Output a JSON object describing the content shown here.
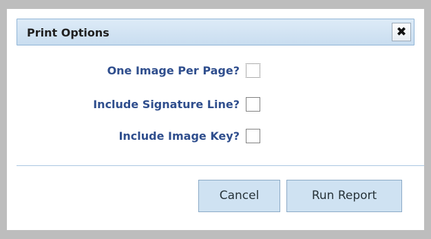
{
  "dialog": {
    "title": "Print Options",
    "close_icon": "close-icon",
    "close_glyph": "✖"
  },
  "options": [
    {
      "label": "One Image Per Page?",
      "checked": false
    },
    {
      "label": "Include Signature Line?",
      "checked": false
    },
    {
      "label": "Include Image Key?",
      "checked": false
    }
  ],
  "buttons": {
    "cancel": "Cancel",
    "run_report": "Run Report"
  },
  "colors": {
    "label": "#2f4e8d",
    "title_bg": "#ddebf7",
    "button_bg": "#cfe2f2",
    "backdrop": "#bdbdbd"
  }
}
